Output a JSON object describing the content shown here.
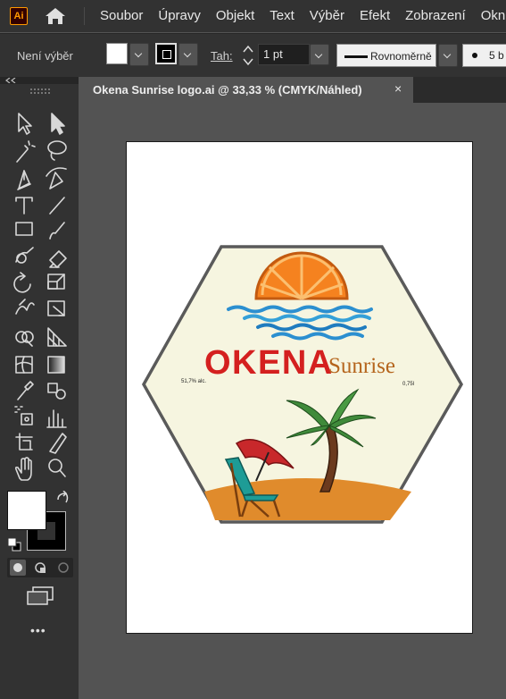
{
  "app": {
    "logo_text": "Ai",
    "accent": "#ff9a00"
  },
  "menu": [
    "Soubor",
    "Úpravy",
    "Objekt",
    "Text",
    "Výběr",
    "Efekt",
    "Zobrazení",
    "Okn"
  ],
  "control_bar": {
    "selection_status": "Není výběr",
    "stroke_label": "Tah:",
    "stroke_weight": "1 pt",
    "stroke_profile": "Rovnoměrně",
    "brush_size": "5 b"
  },
  "document_tab": {
    "title": "Okena Sunrise logo.ai @ 33,33 % (CMYK/Náhled)",
    "close_glyph": "×"
  },
  "artwork": {
    "brand": "OKENA",
    "tagline": "Sunrise",
    "alcohol": "51,7% alc.",
    "volume": "0,75l",
    "colors": {
      "brand_red": "#d4201f",
      "tagline_brown": "#b5651d",
      "orange": "#f5821f",
      "sand": "#e08b2c",
      "sea_blue": "#2b8fd0",
      "palm_green": "#3f8a3a",
      "trunk": "#6b3a1e",
      "badge_bg": "#f6f5e0",
      "hex_border": "#5a5a5a"
    }
  },
  "toolbar": {
    "tools": [
      "selection-tool",
      "direct-selection-tool",
      "magic-wand-tool",
      "lasso-tool",
      "pen-tool",
      "curvature-tool",
      "type-tool",
      "line-tool",
      "rectangle-tool",
      "paintbrush-tool",
      "shaper-tool",
      "eraser-tool",
      "rotate-tool",
      "scale-tool",
      "warp-tool",
      "free-transform-tool",
      "shape-builder-tool",
      "perspective-grid-tool",
      "mesh-tool",
      "gradient-tool",
      "eyedropper-tool",
      "blend-tool",
      "symbol-sprayer-tool",
      "column-graph-tool",
      "artboard-tool",
      "slice-tool",
      "hand-tool",
      "zoom-tool"
    ],
    "more_glyph": "•••"
  }
}
